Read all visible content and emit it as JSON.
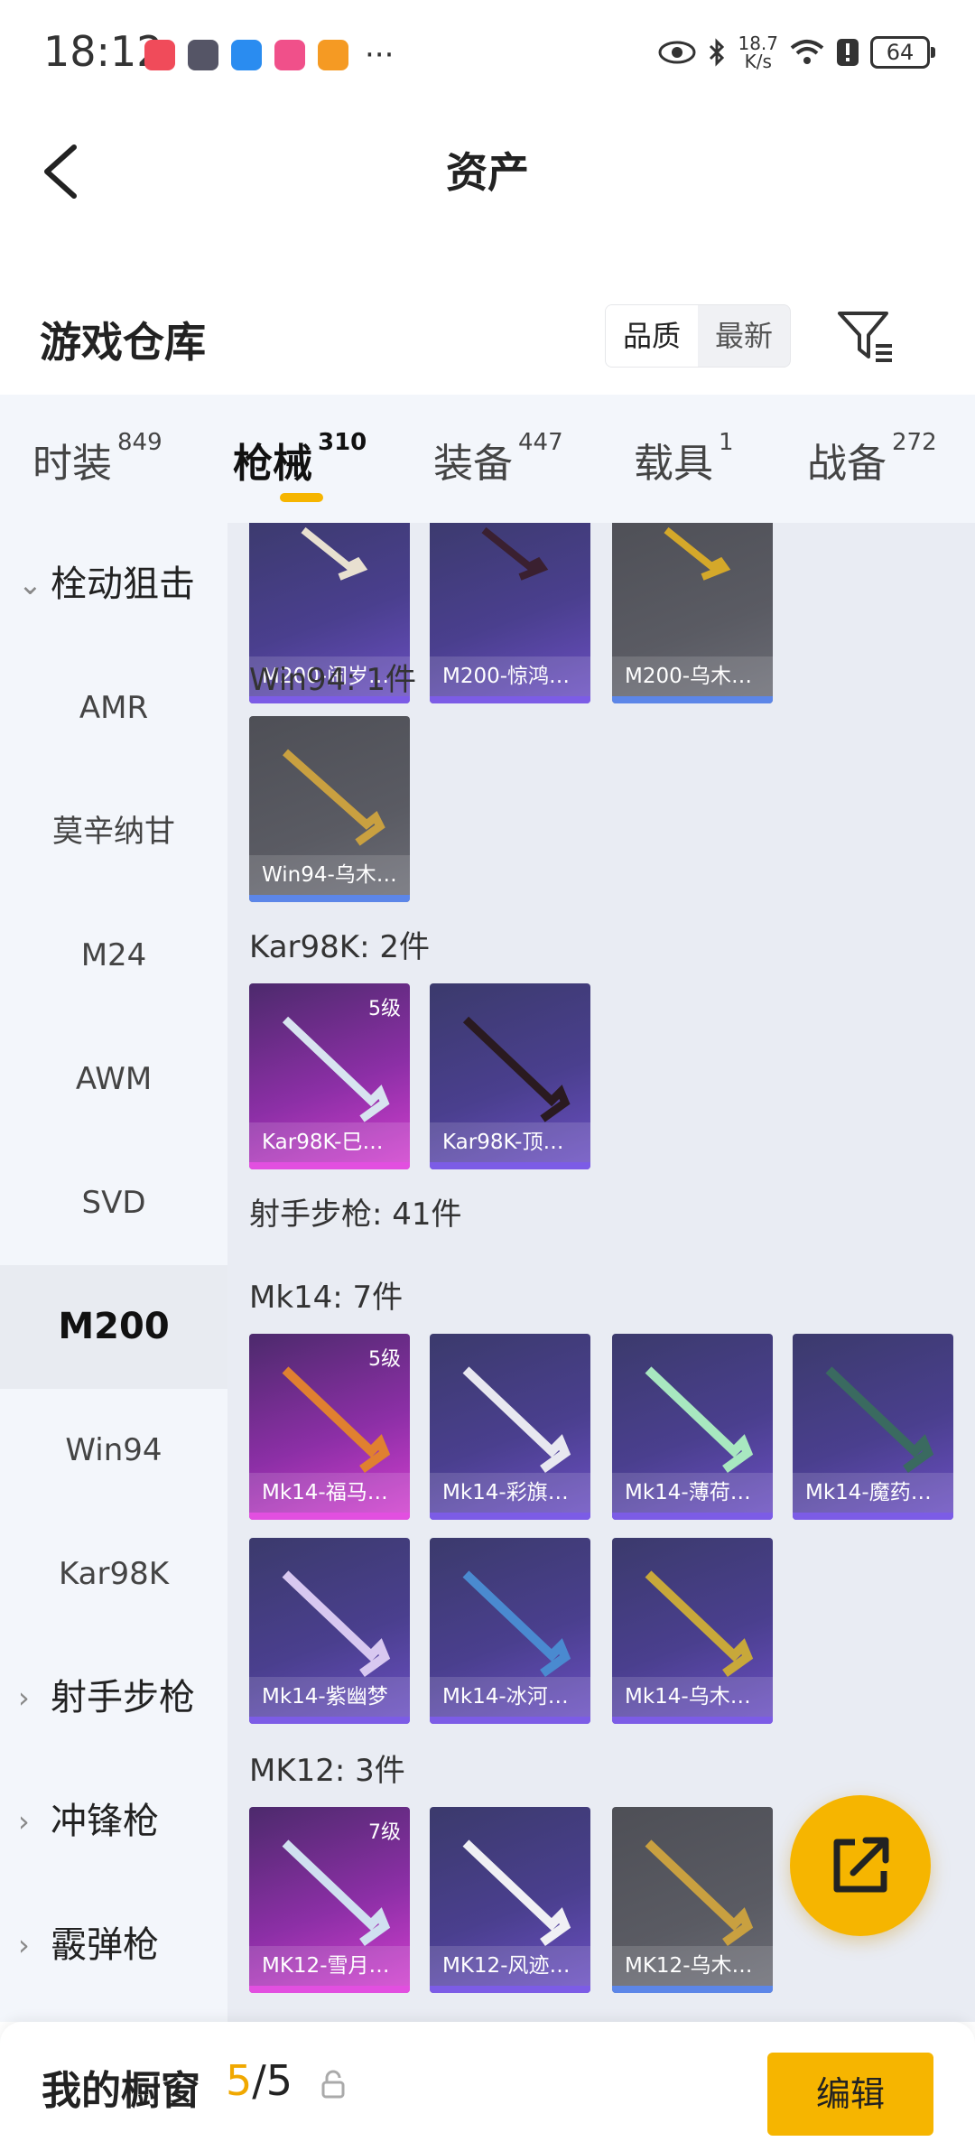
{
  "status_bar": {
    "time": "18:12",
    "net_speed_value": "18.7",
    "net_speed_unit": "K/s",
    "battery": "64"
  },
  "header": {
    "title": "资产"
  },
  "warehouse": {
    "title": "游戏仓库",
    "sort_options": [
      "品质",
      "最新"
    ],
    "active_sort": "品质"
  },
  "tabs": [
    {
      "label": "时装",
      "count": "849"
    },
    {
      "label": "枪械",
      "count": "310",
      "active": true
    },
    {
      "label": "装备",
      "count": "447"
    },
    {
      "label": "载具",
      "count": "1"
    },
    {
      "label": "战备",
      "count": "272"
    }
  ],
  "sidebar": {
    "items": [
      {
        "label": "栓动狙击",
        "type": "group",
        "expanded": true
      },
      {
        "label": "AMR"
      },
      {
        "label": "莫辛纳甘"
      },
      {
        "label": "M24"
      },
      {
        "label": "AWM"
      },
      {
        "label": "SVD"
      },
      {
        "label": "M200",
        "active": true
      },
      {
        "label": "Win94"
      },
      {
        "label": "Kar98K"
      },
      {
        "label": "射手步枪",
        "type": "group"
      },
      {
        "label": "冲锋枪",
        "type": "group"
      },
      {
        "label": "霰弹枪",
        "type": "group"
      }
    ]
  },
  "content": {
    "sections": [
      {
        "label": "Win94: 1件"
      },
      {
        "label": "Kar98K: 2件"
      },
      {
        "label": "射手步枪: 41件"
      },
      {
        "label": "Mk14: 7件"
      },
      {
        "label": "MK12: 3件"
      }
    ],
    "items": [
      {
        "name": "M200-闹岁…",
        "rarity": "purple"
      },
      {
        "name": "M200-惊鸿…",
        "rarity": "purple"
      },
      {
        "name": "M200-乌木…",
        "rarity": "grey"
      },
      {
        "name": "Win94-乌木…",
        "rarity": "grey"
      },
      {
        "name": "Kar98K-巳…",
        "rarity": "pink",
        "level": "5级"
      },
      {
        "name": "Kar98K-顶…",
        "rarity": "purple"
      },
      {
        "name": "Mk14-福马…",
        "rarity": "pink",
        "level": "5级"
      },
      {
        "name": "Mk14-彩旗…",
        "rarity": "purple"
      },
      {
        "name": "Mk14-薄荷…",
        "rarity": "purple"
      },
      {
        "name": "Mk14-魔药…",
        "rarity": "purple"
      },
      {
        "name": "Mk14-紫幽梦",
        "rarity": "purple"
      },
      {
        "name": "Mk14-冰河…",
        "rarity": "purple"
      },
      {
        "name": "Mk14-乌木…",
        "rarity": "purple"
      },
      {
        "name": "MK12-雪月…",
        "rarity": "pink",
        "level": "7级"
      },
      {
        "name": "MK12-风迹…",
        "rarity": "purple"
      },
      {
        "name": "MK12-乌木…",
        "rarity": "grey"
      }
    ]
  },
  "bottom_bar": {
    "title": "我的橱窗",
    "count_current": "5",
    "count_separator": "/",
    "count_total": "5",
    "edit_label": "编辑"
  },
  "colors": {
    "accent": "#f6b500",
    "purple_rarity": "#7c5ce6",
    "pink_rarity": "#e24fe0",
    "grey_rarity": "#5c86e8"
  },
  "icons": [
    "back-arrow-icon",
    "filter-icon",
    "share-icon",
    "lock-icon",
    "eye-icon",
    "bluetooth-icon",
    "wifi-icon",
    "alert-icon"
  ]
}
